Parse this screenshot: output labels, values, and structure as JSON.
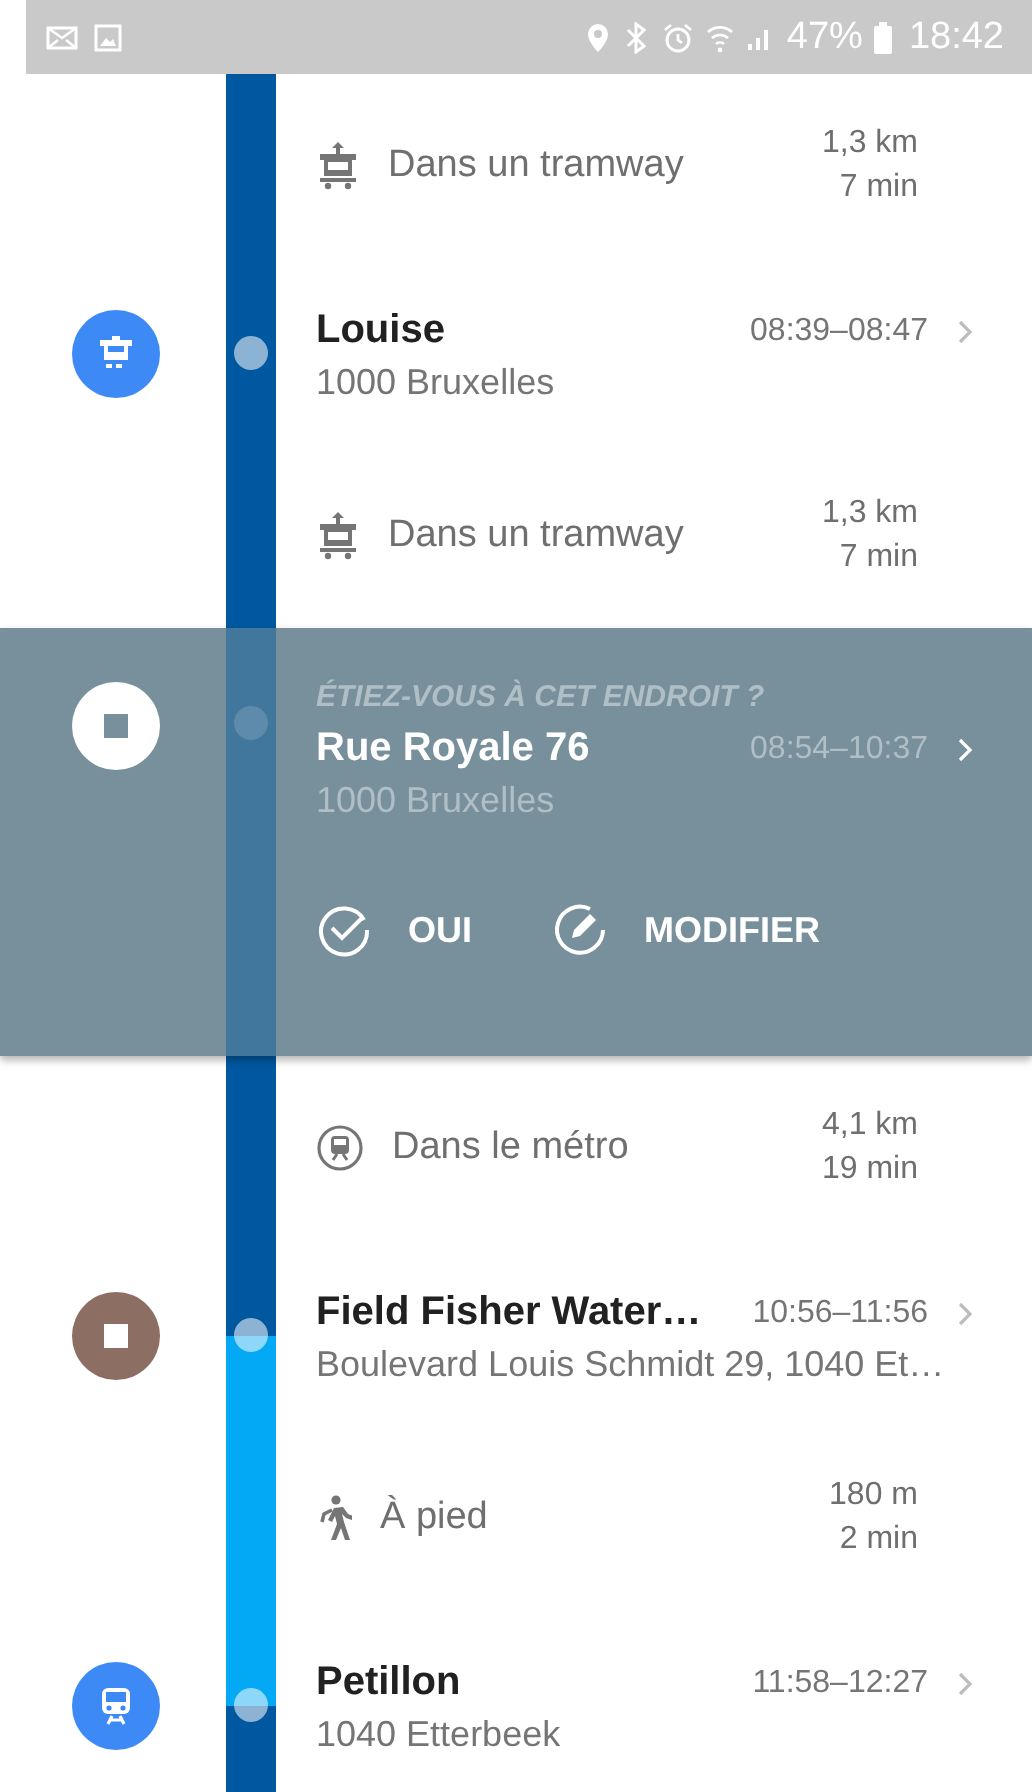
{
  "status_bar": {
    "battery": "47%",
    "time": "18:42"
  },
  "timeline": [
    {
      "kind": "tram",
      "label": "Dans un tramway",
      "distance": "1,3 km",
      "duration": "7 min",
      "color": "#0058a0"
    },
    {
      "kind": "tram_stop",
      "color": "#3d8af7",
      "title": "Louise",
      "address": "1000 Bruxelles",
      "time": "08:39–08:47"
    },
    {
      "kind": "tram",
      "label": "Dans un tramway",
      "distance": "1,3 km",
      "duration": "7 min",
      "color": "#0058a0"
    },
    {
      "kind": "stop",
      "color": "#ffffff",
      "title": "Rue Royale 76",
      "address": "1000 Bruxelles",
      "time": "08:54–10:37",
      "confirm": {
        "prompt": "ÉTIEZ-VOUS À CET ENDROIT ?",
        "actions": [
          {
            "kind": "confirm",
            "label": "OUI"
          },
          {
            "kind": "edit",
            "label": "MODIFIER"
          }
        ]
      }
    },
    {
      "kind": "metro",
      "label": "Dans le métro",
      "distance": "4,1 km",
      "duration": "19 min",
      "color": "#0058a0"
    },
    {
      "kind": "stop",
      "color": "#8d6e63",
      "title": "Field Fisher Water…",
      "address": "Boulevard Louis Schmidt 29, 1040 Et…",
      "time": "10:56–11:56"
    },
    {
      "kind": "walk",
      "label": "À pied",
      "distance": "180 m",
      "duration": "2 min",
      "color": "#03a9f4"
    },
    {
      "kind": "metro_stop",
      "color": "#3d8af7",
      "title": "Petillon",
      "address": "1040 Etterbeek",
      "time": "11:58–12:27"
    }
  ]
}
